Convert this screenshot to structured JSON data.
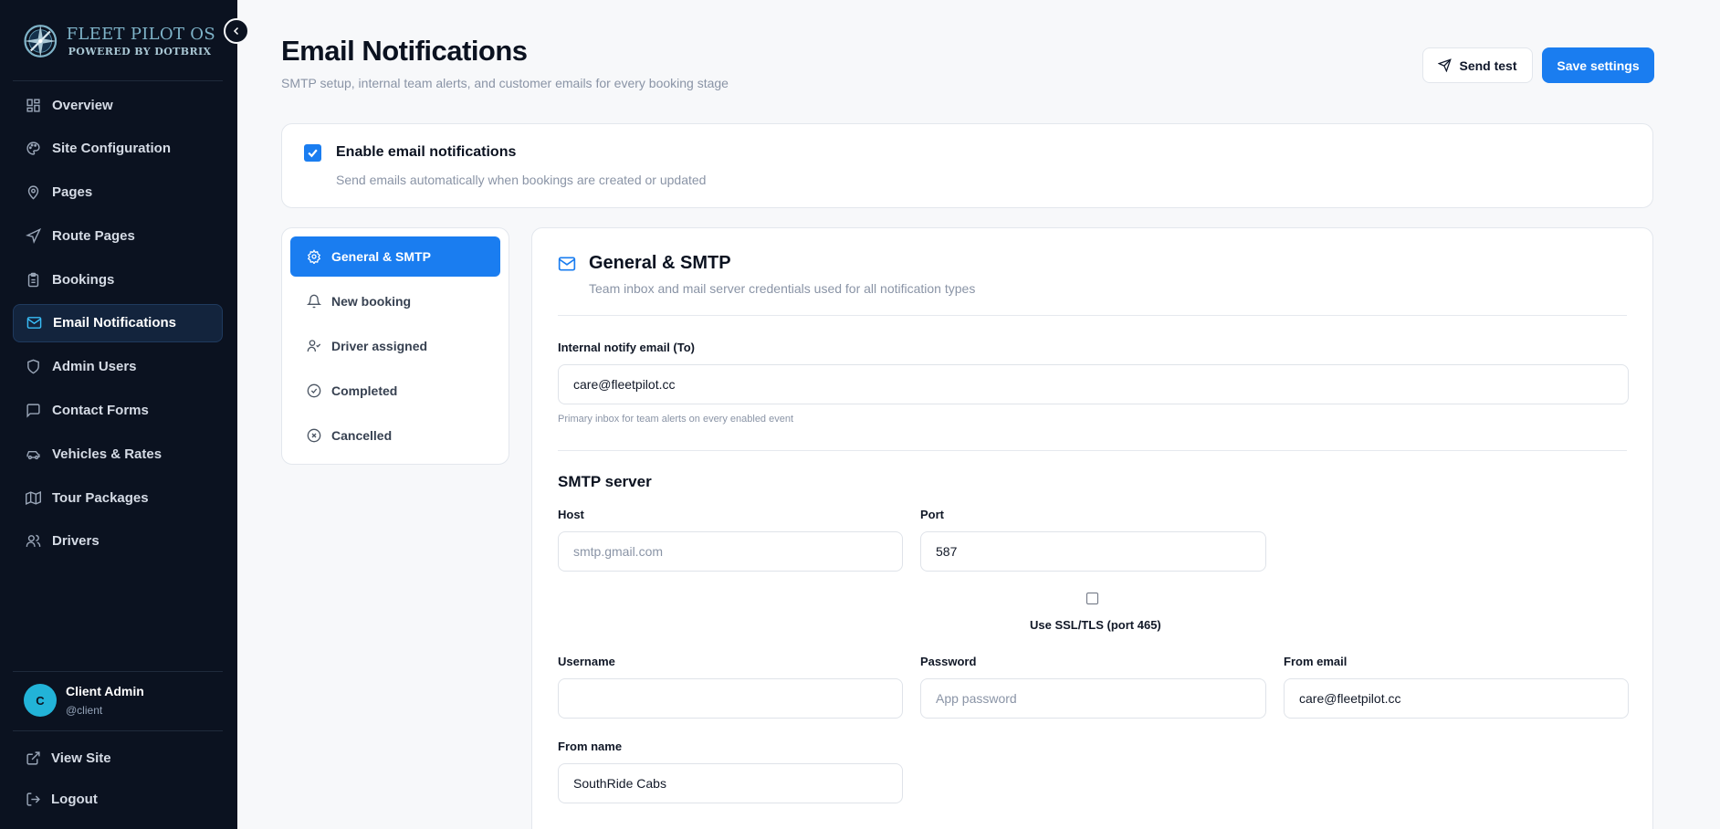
{
  "brand": {
    "title": "FLEET PILOT OS",
    "subtitle": "POWERED BY DOTBRIX"
  },
  "sidebar": {
    "items": [
      {
        "label": "Overview",
        "icon": "grid-icon"
      },
      {
        "label": "Site Configuration",
        "icon": "palette-icon"
      },
      {
        "label": "Pages",
        "icon": "map-pin-icon"
      },
      {
        "label": "Route Pages",
        "icon": "navigation-icon"
      },
      {
        "label": "Bookings",
        "icon": "clipboard-icon"
      },
      {
        "label": "Email Notifications",
        "icon": "mail-icon",
        "active": true
      },
      {
        "label": "Admin Users",
        "icon": "shield-icon"
      },
      {
        "label": "Contact Forms",
        "icon": "message-square-icon"
      },
      {
        "label": "Vehicles & Rates",
        "icon": "car-icon"
      },
      {
        "label": "Tour Packages",
        "icon": "map-icon"
      },
      {
        "label": "Drivers",
        "icon": "users-icon"
      }
    ],
    "user": {
      "initial": "C",
      "name": "Client Admin",
      "handle": "@client"
    },
    "view_site": "View Site",
    "logout": "Logout"
  },
  "header": {
    "title": "Email Notifications",
    "subtitle": "SMTP setup, internal team alerts, and customer emails for every booking stage",
    "send_test": "Send test",
    "save": "Save settings"
  },
  "enable": {
    "checked": true,
    "title": "Enable email notifications",
    "description": "Send emails automatically when bookings are created or updated"
  },
  "tabs": [
    {
      "label": "General & SMTP",
      "icon": "gear-icon",
      "active": true
    },
    {
      "label": "New booking",
      "icon": "bell-icon"
    },
    {
      "label": "Driver assigned",
      "icon": "user-check-icon"
    },
    {
      "label": "Completed",
      "icon": "check-circle-icon"
    },
    {
      "label": "Cancelled",
      "icon": "x-circle-icon"
    }
  ],
  "section": {
    "title": "General & SMTP",
    "description": "Team inbox and mail server credentials used for all notification types"
  },
  "form": {
    "internal_email": {
      "label": "Internal notify email (To)",
      "value": "care@fleetpilot.cc",
      "hint": "Primary inbox for team alerts on every enabled event"
    },
    "smtp_heading": "SMTP server",
    "host": {
      "label": "Host",
      "value": "",
      "placeholder": "smtp.gmail.com"
    },
    "port": {
      "label": "Port",
      "value": "587"
    },
    "ssl": {
      "label": "Use SSL/TLS (port 465)",
      "checked": false
    },
    "username": {
      "label": "Username",
      "value": ""
    },
    "password": {
      "label": "Password",
      "value": "",
      "placeholder": "App password"
    },
    "from_email": {
      "label": "From email",
      "value": "care@fleetpilot.cc"
    },
    "from_name": {
      "label": "From name",
      "value": "SouthRide Cabs"
    }
  },
  "colors": {
    "accent": "#1a7df0",
    "sidebar_bg": "#0b1220",
    "avatar": "#22b3d8"
  }
}
